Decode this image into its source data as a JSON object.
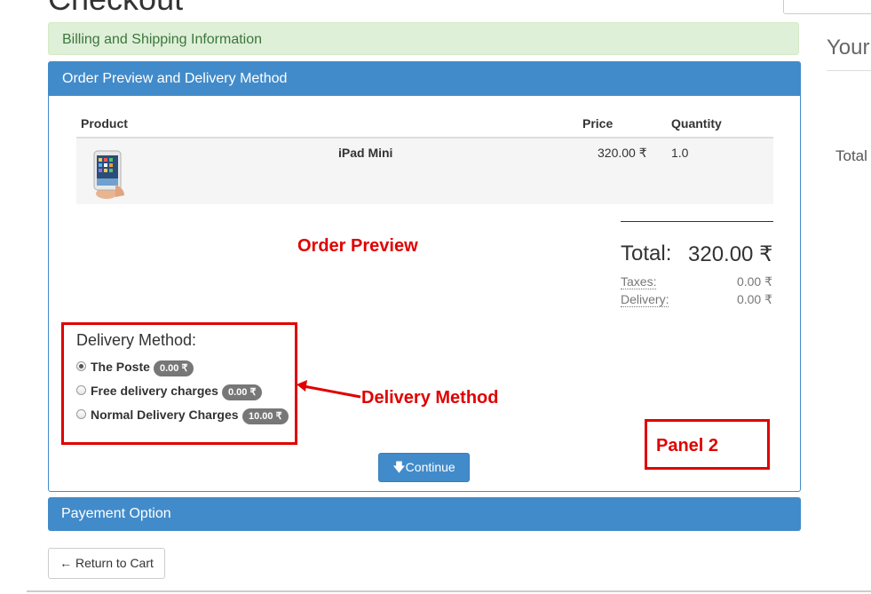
{
  "page": {
    "title": "Checkout"
  },
  "sidebar": {
    "title": "Your",
    "total_label": "Total"
  },
  "billing_panel": {
    "title": "Billing and Shipping Information"
  },
  "order_panel": {
    "title": "Order Preview and Delivery Method",
    "table": {
      "headers": {
        "product": "Product",
        "price": "Price",
        "quantity": "Quantity"
      },
      "rows": [
        {
          "image_icon": "ipad-mini-image",
          "name": "iPad Mini",
          "price": "320.00 ₹",
          "quantity": "1.0"
        }
      ]
    },
    "totals": {
      "total_label": "Total:",
      "total_value": "320.00 ₹",
      "taxes_label": "Taxes:",
      "taxes_value": "0.00 ₹",
      "delivery_label": "Delivery:",
      "delivery_value": "0.00 ₹"
    },
    "delivery": {
      "title": "Delivery Method:",
      "options": [
        {
          "label": "The Poste",
          "price": "0.00 ₹",
          "checked": true
        },
        {
          "label": "Free delivery charges",
          "price": "0.00 ₹",
          "checked": false
        },
        {
          "label": "Normal Delivery Charges",
          "price": "10.00 ₹",
          "checked": false
        }
      ]
    },
    "continue_button": {
      "icon": "arrow-down-icon",
      "label": "Continue"
    }
  },
  "payment_panel": {
    "title": "Payement Option"
  },
  "return_button": {
    "icon": "arrow-left-icon",
    "label": "Return to Cart"
  },
  "annotations": {
    "order_preview": "Order Preview",
    "delivery_method": "Delivery Method",
    "panel_2": "Panel 2",
    "color": "#e00000"
  },
  "colors": {
    "primary": "#428bca",
    "success_bg": "#dff0d8",
    "success_text": "#3c763d",
    "badge": "#777777"
  }
}
